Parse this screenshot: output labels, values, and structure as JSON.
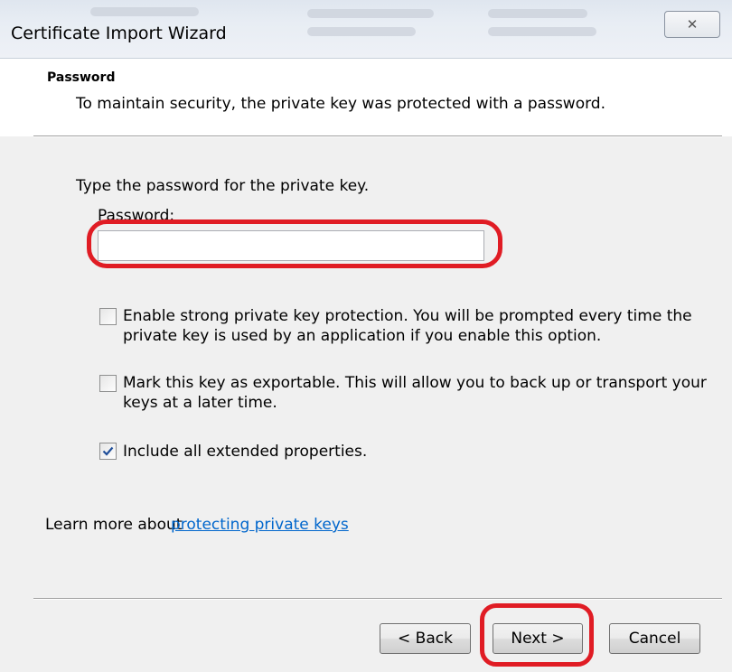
{
  "window": {
    "title": "Certificate Import Wizard",
    "close_glyph": "✕"
  },
  "header": {
    "title": "Password",
    "subtitle": "To maintain security, the private key was protected with a password."
  },
  "main": {
    "instruction": "Type the password for the private key.",
    "password_label": "Password:",
    "password_value": "",
    "options": [
      {
        "label_line1": "Enable strong private key protection. You will be prompted every time the",
        "label_line2": "private key is used by an application if you enable this option.",
        "checked": false
      },
      {
        "label_line1": "Mark this key as exportable. This will allow you to back up or transport your",
        "label_line2": "keys at a later time.",
        "checked": false
      },
      {
        "label_line1": "Include all extended properties.",
        "label_line2": "",
        "checked": true
      }
    ],
    "learn_more_prefix": "Learn more about ",
    "learn_more_link": "protecting private keys"
  },
  "footer": {
    "back_label": "< Back",
    "next_label": "Next >",
    "cancel_label": "Cancel"
  },
  "colors": {
    "highlight": "#e01c24",
    "link": "#0066cc",
    "check": "#1f4e99"
  },
  "icons": {
    "close": "close-icon",
    "check": "checkmark-icon"
  }
}
